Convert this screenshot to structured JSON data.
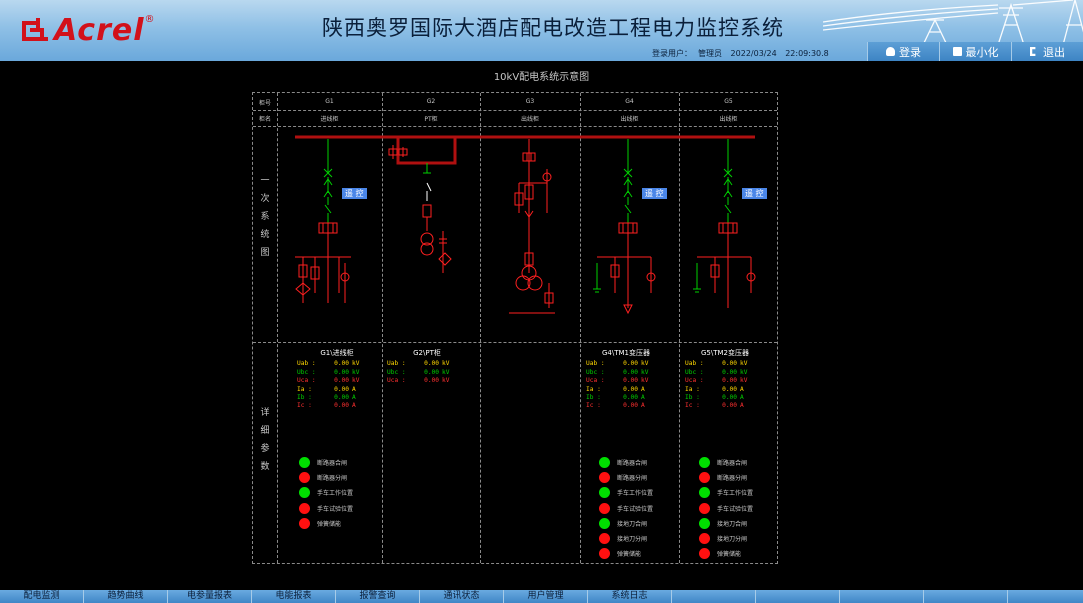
{
  "header": {
    "brand": "Acrel",
    "reg_mark": "®",
    "title": "陕西奥罗国际大酒店配电改造工程电力监控系统",
    "login_label": "登录用户：",
    "login_user": "管理员",
    "date": "2022/03/24",
    "time": "22:09:30.8",
    "buttons": {
      "login": "登录",
      "minimize": "最小化",
      "exit": "退出"
    }
  },
  "diagram": {
    "title": "10kV配电系统示意图",
    "row_label_no": "柜号",
    "row_label_name": "柜名",
    "side_label_primary": [
      "一",
      "次",
      "系",
      "统",
      "图"
    ],
    "side_label_detail": [
      "详",
      "细",
      "参",
      "数"
    ],
    "remote_label": "遥 控",
    "cabinets": [
      {
        "no": "G1",
        "name": "进线柜"
      },
      {
        "no": "G2",
        "name": "PT柜"
      },
      {
        "no": "G3",
        "name": "出线柜"
      },
      {
        "no": "G4",
        "name": "出线柜"
      },
      {
        "no": "G5",
        "name": "出线柜"
      }
    ],
    "params": [
      {
        "title": "G1\\进线柜",
        "rows": [
          {
            "name": "Uab :",
            "value": "0.00",
            "unit": "kV",
            "color": "yellow"
          },
          {
            "name": "Ubc :",
            "value": "0.00",
            "unit": "kV",
            "color": "green"
          },
          {
            "name": "Uca :",
            "value": "0.00",
            "unit": "kV",
            "color": "red"
          },
          {
            "name": "Ia :",
            "value": "0.00",
            "unit": "A",
            "color": "yellow"
          },
          {
            "name": "Ib :",
            "value": "0.00",
            "unit": "A",
            "color": "green"
          },
          {
            "name": "Ic :",
            "value": "0.00",
            "unit": "A",
            "color": "red"
          }
        ]
      },
      {
        "title": "G2\\PT柜",
        "rows": [
          {
            "name": "Uab :",
            "value": "0.00",
            "unit": "kV",
            "color": "yellow"
          },
          {
            "name": "Ubc :",
            "value": "0.00",
            "unit": "kV",
            "color": "green"
          },
          {
            "name": "Uca :",
            "value": "0.00",
            "unit": "kV",
            "color": "red"
          }
        ]
      },
      {
        "title": "G4\\TM1变压器",
        "rows": [
          {
            "name": "Uab :",
            "value": "0.00",
            "unit": "kV",
            "color": "yellow"
          },
          {
            "name": "Ubc :",
            "value": "0.00",
            "unit": "kV",
            "color": "green"
          },
          {
            "name": "Uca :",
            "value": "0.00",
            "unit": "kV",
            "color": "red"
          },
          {
            "name": "Ia :",
            "value": "0.00",
            "unit": "A",
            "color": "yellow"
          },
          {
            "name": "Ib :",
            "value": "0.00",
            "unit": "A",
            "color": "green"
          },
          {
            "name": "Ic :",
            "value": "0.00",
            "unit": "A",
            "color": "red"
          }
        ]
      },
      {
        "title": "G5\\TM2变压器",
        "rows": [
          {
            "name": "Uab :",
            "value": "0.00",
            "unit": "kV",
            "color": "yellow"
          },
          {
            "name": "Ubc :",
            "value": "0.00",
            "unit": "kV",
            "color": "green"
          },
          {
            "name": "Uca :",
            "value": "0.00",
            "unit": "kV",
            "color": "red"
          },
          {
            "name": "Ia :",
            "value": "0.00",
            "unit": "A",
            "color": "yellow"
          },
          {
            "name": "Ib :",
            "value": "0.00",
            "unit": "A",
            "color": "green"
          },
          {
            "name": "Ic :",
            "value": "0.00",
            "unit": "A",
            "color": "red"
          }
        ]
      }
    ],
    "status": [
      {
        "items": [
          {
            "label": "断路器合闸",
            "state": "on"
          },
          {
            "label": "断路器分闸",
            "state": "off"
          },
          {
            "label": "手车工作位置",
            "state": "on"
          },
          {
            "label": "手车试验位置",
            "state": "off"
          },
          {
            "label": "弹簧储能",
            "state": "off"
          }
        ]
      },
      {
        "items": [
          {
            "label": "断路器合闸",
            "state": "on"
          },
          {
            "label": "断路器分闸",
            "state": "off"
          },
          {
            "label": "手车工作位置",
            "state": "on"
          },
          {
            "label": "手车试验位置",
            "state": "off"
          },
          {
            "label": "接地刀合闸",
            "state": "on"
          },
          {
            "label": "接地刀分闸",
            "state": "off"
          },
          {
            "label": "弹簧储能",
            "state": "off"
          }
        ]
      },
      {
        "items": [
          {
            "label": "断路器合闸",
            "state": "on"
          },
          {
            "label": "断路器分闸",
            "state": "off"
          },
          {
            "label": "手车工作位置",
            "state": "on"
          },
          {
            "label": "手车试验位置",
            "state": "off"
          },
          {
            "label": "接地刀合闸",
            "state": "on"
          },
          {
            "label": "接地刀分闸",
            "state": "off"
          },
          {
            "label": "弹簧储能",
            "state": "off"
          }
        ]
      }
    ]
  },
  "nav": {
    "items": [
      "配电监测",
      "趋势曲线",
      "电参量报表",
      "电能报表",
      "报警查询",
      "通讯状态",
      "用户管理",
      "系统日志"
    ]
  },
  "colors": {
    "bus": "#b01010",
    "green_line": "#00d000",
    "red_line": "#ff2020",
    "header_blue": "#6aa8db"
  }
}
